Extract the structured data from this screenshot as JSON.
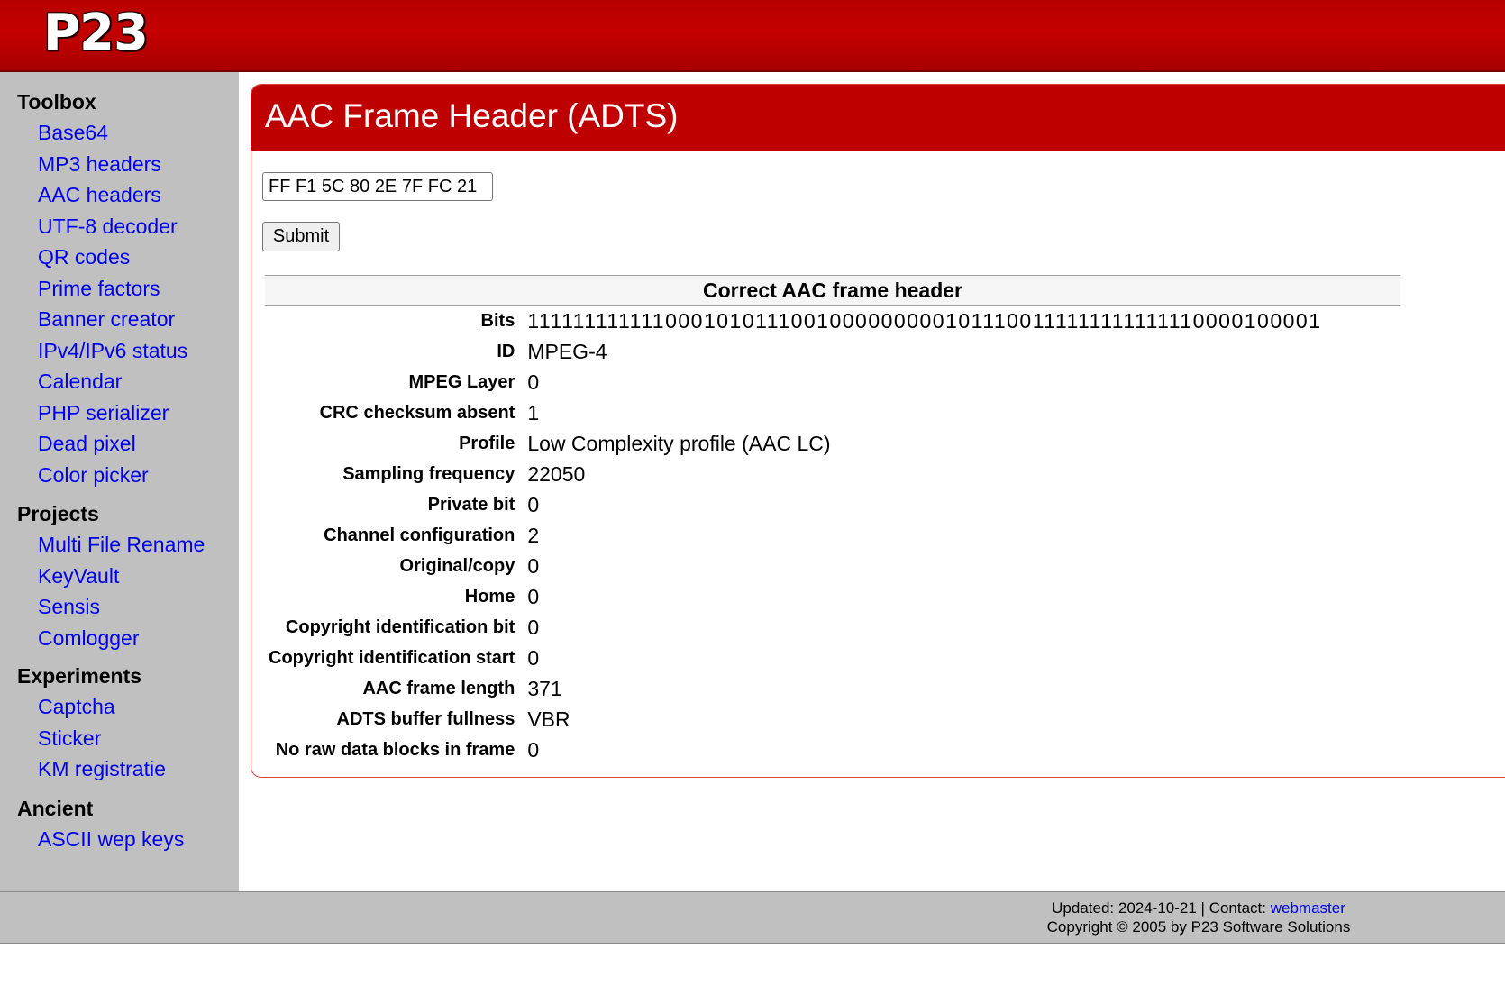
{
  "header": {
    "logo_text": "P23"
  },
  "sidebar": {
    "groups": [
      {
        "heading": "Toolbox",
        "links": [
          "Base64",
          "MP3 headers",
          "AAC headers",
          "UTF-8 decoder",
          "QR codes",
          "Prime factors",
          "Banner creator",
          "IPv4/IPv6 status",
          "Calendar",
          "PHP serializer",
          "Dead pixel",
          "Color picker"
        ]
      },
      {
        "heading": "Projects",
        "links": [
          "Multi File Rename",
          "KeyVault",
          "Sensis",
          "Comlogger"
        ]
      },
      {
        "heading": "Experiments",
        "links": [
          "Captcha",
          "Sticker",
          "KM registratie"
        ]
      },
      {
        "heading": "Ancient",
        "links": [
          "ASCII wep keys"
        ]
      }
    ]
  },
  "main": {
    "title": "AAC Frame Header (ADTS)",
    "input_value": "FF F1 5C 80 2E 7F FC 21",
    "submit_label": "Submit",
    "table_heading": "Correct AAC frame header",
    "rows": [
      {
        "label": "Bits",
        "value": "11111111111100010101110010000000001011100111111111111110000100001"
      },
      {
        "label": "ID",
        "value": "MPEG-4"
      },
      {
        "label": "MPEG Layer",
        "value": "0"
      },
      {
        "label": "CRC checksum absent",
        "value": "1"
      },
      {
        "label": "Profile",
        "value": "Low Complexity profile (AAC LC)"
      },
      {
        "label": "Sampling frequency",
        "value": "22050"
      },
      {
        "label": "Private bit",
        "value": "0"
      },
      {
        "label": "Channel configuration",
        "value": "2"
      },
      {
        "label": "Original/copy",
        "value": "0"
      },
      {
        "label": "Home",
        "value": "0"
      },
      {
        "label": "Copyright identification bit",
        "value": "0"
      },
      {
        "label": "Copyright identification start",
        "value": "0"
      },
      {
        "label": "AAC frame length",
        "value": "371"
      },
      {
        "label": "ADTS buffer fullness",
        "value": "VBR"
      },
      {
        "label": "No raw data blocks in frame",
        "value": "0"
      }
    ]
  },
  "footer": {
    "updated_text": "Updated: 2024-10-21 | Contact: ",
    "contact_link": "webmaster",
    "copyright_text": "Copyright © 2005 by P23 Software Solutions"
  }
}
